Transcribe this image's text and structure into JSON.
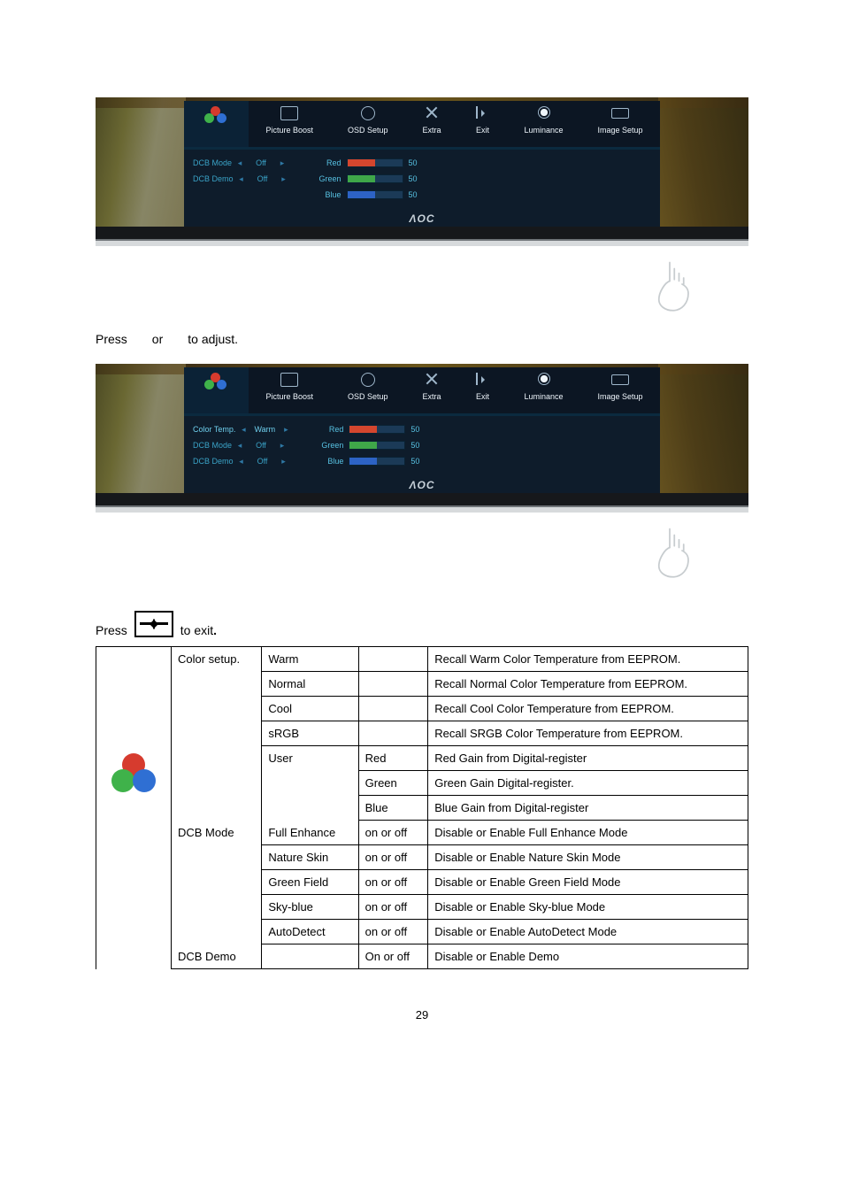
{
  "page_number": "29",
  "aoc": "ΛOC",
  "osd_tabs": [
    {
      "id": "color-temp",
      "label": "",
      "icon": "rgb-circles"
    },
    {
      "id": "picture-boost",
      "label": "Picture Boost",
      "icon": "box"
    },
    {
      "id": "osd-setup",
      "label": "OSD Setup",
      "icon": "gear"
    },
    {
      "id": "extra",
      "label": "Extra",
      "icon": "x"
    },
    {
      "id": "exit",
      "label": "Exit",
      "icon": "exit"
    },
    {
      "id": "luminance",
      "label": "Luminance",
      "icon": "sun"
    },
    {
      "id": "image-setup",
      "label": "Image Setup",
      "icon": "img"
    }
  ],
  "osd1": {
    "settings": [
      {
        "name": "DCB Mode",
        "value": "Off"
      },
      {
        "name": "DCB Demo",
        "value": "Off"
      }
    ],
    "bars": [
      {
        "name": "Red",
        "value": "50"
      },
      {
        "name": "Green",
        "value": "50"
      },
      {
        "name": "Blue",
        "value": "50"
      }
    ]
  },
  "osd2": {
    "settings": [
      {
        "name": "Color Temp.",
        "value": "Warm",
        "active": true
      },
      {
        "name": "DCB Mode",
        "value": "Off"
      },
      {
        "name": "DCB Demo",
        "value": "Off"
      }
    ],
    "bars": [
      {
        "name": "Red",
        "value": "50"
      },
      {
        "name": "Green",
        "value": "50"
      },
      {
        "name": "Blue",
        "value": "50"
      }
    ]
  },
  "text_adjust_a": "Press",
  "text_adjust_b": "or",
  "text_adjust_c": "to adjust.",
  "text_exit_a": "Press",
  "text_exit_b": "to exit",
  "text_exit_dot": ".",
  "table": {
    "group1": "Color setup.",
    "group2": "DCB Mode",
    "group3": "DCB Demo",
    "rows": [
      {
        "opt": "Warm",
        "arg": "",
        "desc": "Recall Warm Color Temperature from EEPROM."
      },
      {
        "opt": "Normal",
        "arg": "",
        "desc": "Recall Normal Color Temperature from EEPROM."
      },
      {
        "opt": "Cool",
        "arg": "",
        "desc": "Recall Cool Color Temperature from EEPROM."
      },
      {
        "opt": "sRGB",
        "arg": "",
        "desc": "Recall SRGB Color Temperature from EEPROM."
      },
      {
        "opt": "User",
        "arg": "Red",
        "desc": "Red Gain from Digital-register"
      },
      {
        "opt": "",
        "arg": "Green",
        "desc": "Green Gain Digital-register."
      },
      {
        "opt": "",
        "arg": "Blue",
        "desc": "Blue Gain from Digital-register"
      },
      {
        "opt": "Full Enhance",
        "arg": "on or off",
        "desc": "Disable or Enable Full Enhance Mode"
      },
      {
        "opt": "Nature Skin",
        "arg": "on or off",
        "desc": "Disable or Enable Nature Skin Mode"
      },
      {
        "opt": "Green Field",
        "arg": "on or off",
        "desc": "Disable or Enable Green Field Mode"
      },
      {
        "opt": "Sky-blue",
        "arg": "on or off",
        "desc": "Disable or Enable Sky-blue Mode"
      },
      {
        "opt": "AutoDetect",
        "arg": "on or off",
        "desc": "Disable or Enable AutoDetect Mode"
      },
      {
        "opt": "",
        "arg": "On or off",
        "desc": "Disable or Enable Demo"
      }
    ]
  }
}
